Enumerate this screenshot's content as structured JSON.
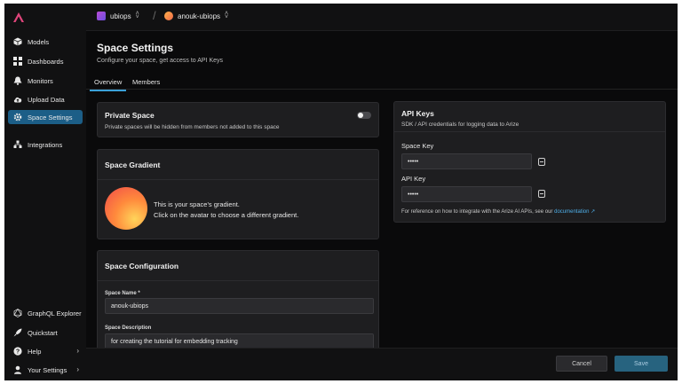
{
  "sidebar": {
    "items": [
      {
        "label": "Models",
        "icon": "cube-icon"
      },
      {
        "label": "Dashboards",
        "icon": "grid-icon"
      },
      {
        "label": "Monitors",
        "icon": "bell-icon"
      },
      {
        "label": "Upload Data",
        "icon": "cloud-upload-icon"
      },
      {
        "label": "Space Settings",
        "icon": "gear-icon",
        "active": true
      },
      {
        "label": "Integrations",
        "icon": "integrations-icon"
      }
    ],
    "bottom_items": [
      {
        "label": "GraphQL Explorer",
        "icon": "graphql-icon"
      },
      {
        "label": "Quickstart",
        "icon": "rocket-icon"
      },
      {
        "label": "Help",
        "icon": "help-icon"
      },
      {
        "label": "Your Settings",
        "icon": "user-icon"
      }
    ]
  },
  "topbar": {
    "org": "ubiops",
    "space": "anouk-ubiops"
  },
  "page": {
    "title": "Space Settings",
    "subtitle": "Configure your space, get access to API Keys",
    "tabs": [
      "Overview",
      "Members"
    ]
  },
  "private_space": {
    "title": "Private Space",
    "description": "Private spaces will be hidden from members not added to this space",
    "enabled": false
  },
  "gradient": {
    "title": "Space Gradient",
    "line1": "This is your space's gradient.",
    "line2": "Click on the avatar to choose a different gradient."
  },
  "config": {
    "title": "Space Configuration",
    "name_label": "Space Name *",
    "name_value": "anouk-ubiops",
    "desc_label": "Space Description",
    "desc_value": "for creating the tutorial for embedding tracking"
  },
  "api_keys": {
    "title": "API Keys",
    "subtitle": "SDK / API credentials for logging data to Arize",
    "space_key_label": "Space Key",
    "space_key_value": "•••••",
    "api_key_label": "API Key",
    "api_key_value": "•••••",
    "note": "For reference on how to integrate with the Arize AI APIs, see our",
    "link": "documentation"
  },
  "footer": {
    "cancel": "Cancel",
    "save": "Save"
  },
  "colors": {
    "accent": "#3aa0d8",
    "brand_logo": "#e0457b",
    "active_nav": "#1c5e87"
  }
}
